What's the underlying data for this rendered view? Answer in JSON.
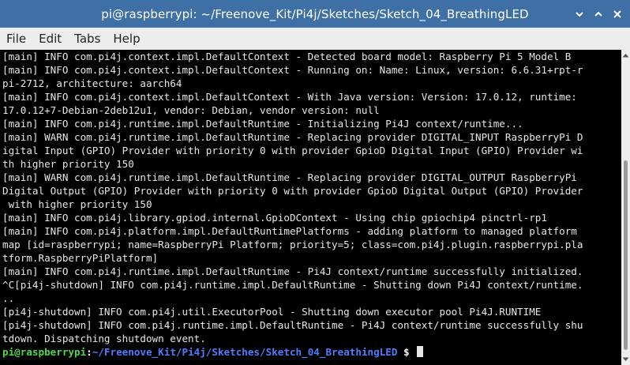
{
  "window": {
    "title": "pi@raspberrypi: ~/Freenove_Kit/Pi4j/Sketches/Sketch_04_BreathingLED",
    "buttons": [
      "minimize",
      "maximize",
      "close"
    ]
  },
  "menu": [
    "File",
    "Edit",
    "Tabs",
    "Help"
  ],
  "terminal": {
    "lines": [
      "[main] INFO com.pi4j.context.impl.DefaultContext - Detected board model: Raspberry Pi 5 Model B",
      "[main] INFO com.pi4j.context.impl.DefaultContext - Running on: Name: Linux, version: 6.6.31+rpt-r",
      "pi-2712, architecture: aarch64",
      "[main] INFO com.pi4j.context.impl.DefaultContext - With Java version: Version: 17.0.12, runtime:",
      "17.0.12+7-Debian-2deb12u1, vendor: Debian, vendor version: null",
      "[main] INFO com.pi4j.runtime.impl.DefaultRuntime - Initializing Pi4J context/runtime...",
      "[main] WARN com.pi4j.runtime.impl.DefaultRuntime - Replacing provider DIGITAL_INPUT RaspberryPi D",
      "igital Input (GPIO) Provider with priority 0 with provider GpioD Digital Input (GPIO) Provider wi",
      "th higher priority 150",
      "[main] WARN com.pi4j.runtime.impl.DefaultRuntime - Replacing provider DIGITAL_OUTPUT RaspberryPi",
      "Digital Output (GPIO) Provider with priority 0 with provider GpioD Digital Output (GPIO) Provider",
      " with higher priority 150",
      "[main] INFO com.pi4j.library.gpiod.internal.GpioDContext - Using chip gpiochip4 pinctrl-rp1",
      "[main] INFO com.pi4j.platform.impl.DefaultRuntimePlatforms - adding platform to managed platform",
      "map [id=raspberrypi; name=RaspberryPi Platform; priority=5; class=com.pi4j.plugin.raspberrypi.pla",
      "tform.RaspberryPiPlatform]",
      "[main] INFO com.pi4j.runtime.impl.DefaultRuntime - Pi4J context/runtime successfully initialized.",
      "^C[pi4j-shutdown] INFO com.pi4j.runtime.impl.DefaultRuntime - Shutting down Pi4J context/runtime.",
      "..",
      "[pi4j-shutdown] INFO com.pi4j.util.ExecutorPool - Shutting down executor pool Pi4J.RUNTIME",
      "[pi4j-shutdown] INFO com.pi4j.runtime.impl.DefaultRuntime - Pi4J context/runtime successfully shu",
      "tdown. Dispatching shutdown event."
    ],
    "prompt": {
      "user": "pi@raspberrypi",
      "separator": ":",
      "path": "~/Freenove_Kit/Pi4j/Sketches/Sketch_04_BreathingLED",
      "symbol": " $ "
    }
  },
  "colors": {
    "titlebar": "#3e6fa5",
    "menubar": "#ededed",
    "terminal_bg": "#000000",
    "terminal_fg": "#e6e6e6",
    "prompt_user": "#4cd94c",
    "prompt_path": "#4f7dff"
  }
}
